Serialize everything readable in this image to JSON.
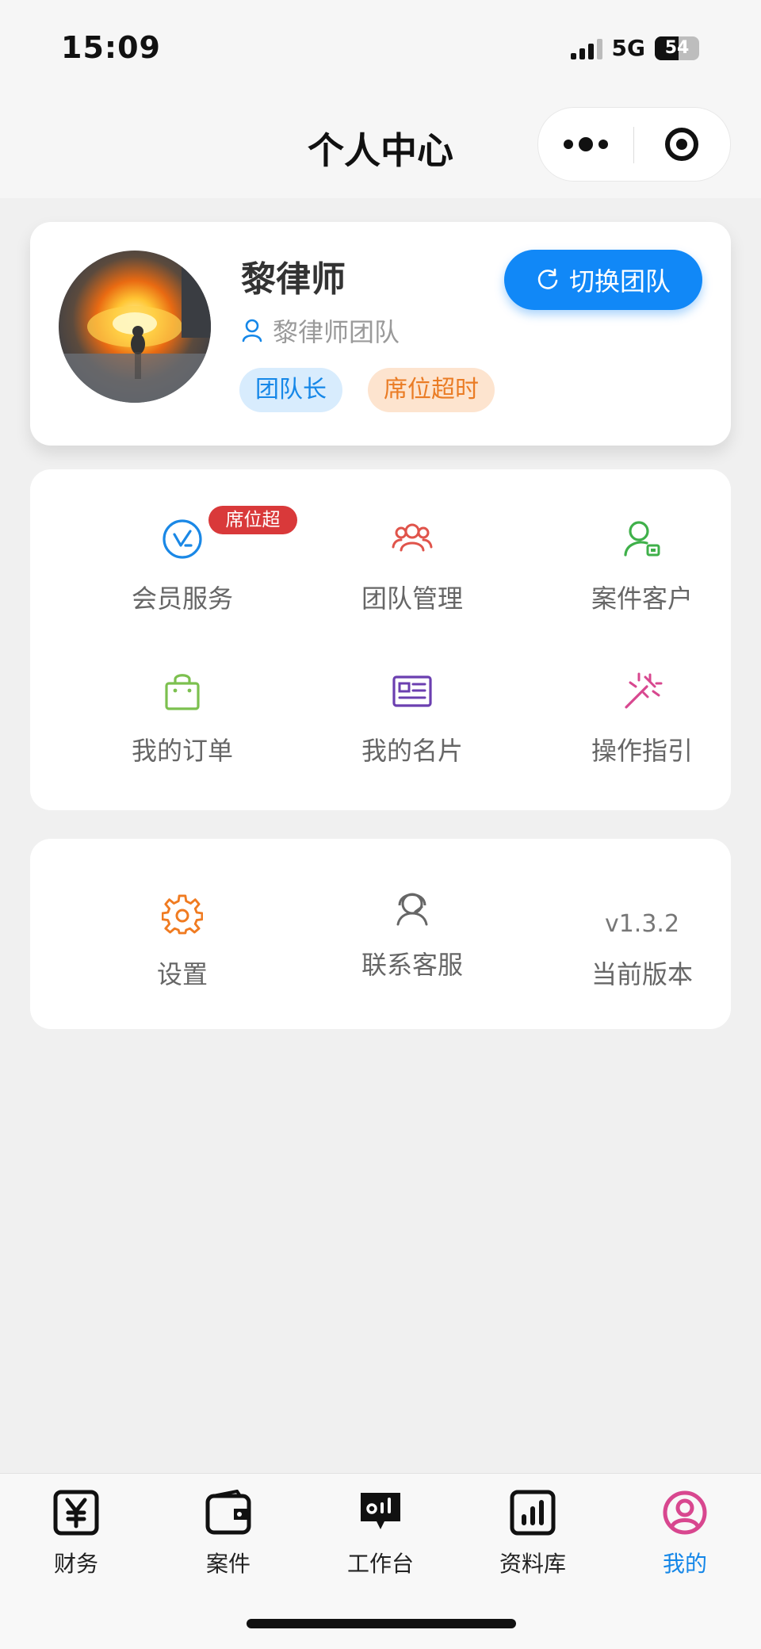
{
  "status_bar": {
    "time": "15:09",
    "network": "5G",
    "battery": "54",
    "battery_level": 0.54
  },
  "nav": {
    "title": "个人中心"
  },
  "profile": {
    "name": "黎律师",
    "team": "黎律师团队",
    "switch_label": "切换团队",
    "tags": [
      "团队长",
      "席位超时"
    ]
  },
  "menu": {
    "items": [
      {
        "label": "会员服务",
        "icon": "vip-icon",
        "color": "#1a88e6",
        "badge": "席位超时"
      },
      {
        "label": "团队管理",
        "icon": "team-icon",
        "color": "#e0544b"
      },
      {
        "label": "案件客户",
        "icon": "client-icon",
        "color": "#3fb04a"
      },
      {
        "label": "我的订单",
        "icon": "bag-icon",
        "color": "#7cc04f"
      },
      {
        "label": "我的名片",
        "icon": "card-icon",
        "color": "#6b3fb0"
      },
      {
        "label": "操作指引",
        "icon": "wand-icon",
        "color": "#d8478f"
      }
    ]
  },
  "settings": {
    "items": [
      {
        "label": "设置",
        "icon": "gear-icon",
        "color": "#f07b21"
      },
      {
        "label": "联系客服",
        "icon": "support-icon",
        "color": "#666666"
      },
      {
        "label": "当前版本",
        "value": "v1.3.2"
      }
    ]
  },
  "tabbar": {
    "items": [
      {
        "label": "财务",
        "icon": "yen-icon"
      },
      {
        "label": "案件",
        "icon": "wallet-icon"
      },
      {
        "label": "工作台",
        "icon": "workbench-icon"
      },
      {
        "label": "资料库",
        "icon": "chart-icon"
      },
      {
        "label": "我的",
        "icon": "profile-icon",
        "active": true
      }
    ],
    "active_color": "#1587e8"
  }
}
